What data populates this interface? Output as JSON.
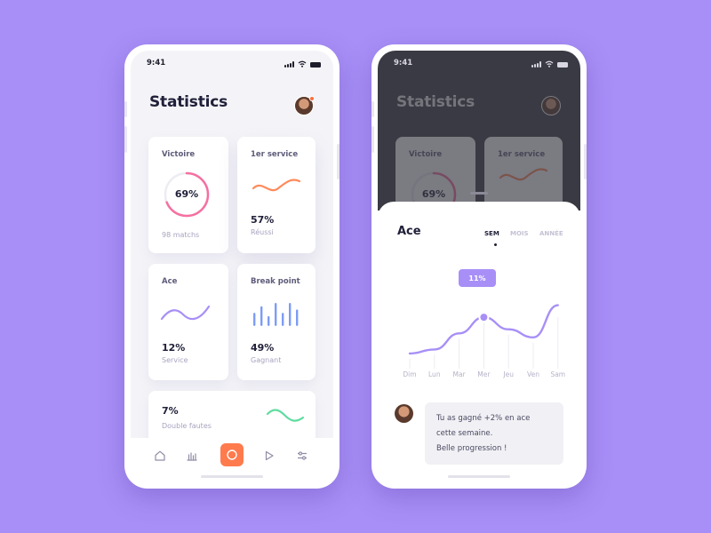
{
  "colors": {
    "background": "#a88ff7",
    "accent_purple": "#a88ff7",
    "accent_orange": "#ff7a4d",
    "accent_pink": "#f66fa0",
    "accent_blue": "#7d9cf6",
    "accent_green": "#5fdca0",
    "text_dark": "#20203a"
  },
  "left_phone": {
    "status": {
      "time": "9:41"
    },
    "title": "Statistics",
    "cards": {
      "victoire": {
        "label": "Victoire",
        "value": "69%",
        "progress": 0.69,
        "sub": "98 matchs"
      },
      "service": {
        "label": "1er service",
        "value": "57%",
        "sub": "Réussi"
      },
      "ace": {
        "label": "Ace",
        "value": "12%",
        "sub": "Service"
      },
      "break_point": {
        "label": "Break point",
        "value": "49%",
        "sub": "Gagnant",
        "bar_values": [
          4,
          6,
          3,
          7,
          4,
          7,
          5
        ]
      },
      "double_faults": {
        "value": "7%",
        "sub": "Double fautes"
      }
    },
    "nav": [
      "home-icon",
      "stats-icon",
      "record-icon",
      "play-icon",
      "settings-sliders-icon"
    ]
  },
  "right_phone": {
    "status": {
      "time": "9:41"
    },
    "title": "Statistics",
    "dim_cards": {
      "victoire": {
        "label": "Victoire",
        "value": "69%"
      },
      "service": {
        "label": "1er service"
      }
    },
    "sheet": {
      "title": "Ace",
      "tabs": [
        "SEM",
        "MOIS",
        "ANNÉE"
      ],
      "active_tab": "SEM",
      "tooltip": "11%",
      "chart_data": {
        "type": "line",
        "x": [
          "Dim",
          "Lun",
          "Mar",
          "Mer",
          "Jeu",
          "Ven",
          "Sam"
        ],
        "series": [
          {
            "values": [
              2,
              3,
              7,
              11,
              8,
              6,
              14
            ]
          }
        ],
        "highlight": {
          "x": "Mer",
          "value": 11
        }
      },
      "message": {
        "line1": "Tu as gagné +2% en ace",
        "line2": "cette semaine.",
        "line3": "Belle progression !"
      }
    }
  }
}
